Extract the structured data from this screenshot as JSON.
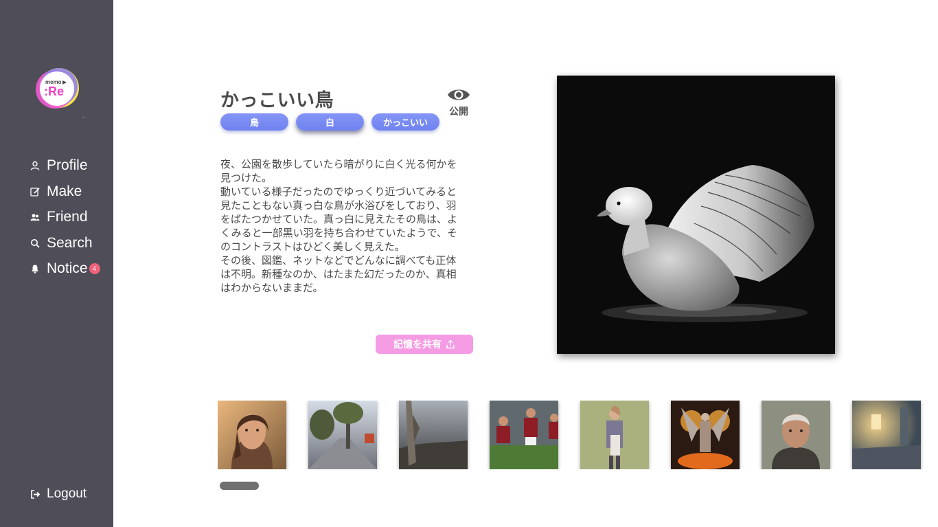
{
  "sidebar": {
    "logo_text_small": "memo",
    "logo_text_main": ":Re",
    "items": [
      {
        "label": "Profile",
        "icon": "user-icon"
      },
      {
        "label": "Make",
        "icon": "edit-icon"
      },
      {
        "label": "Friend",
        "icon": "friends-icon"
      },
      {
        "label": "Search",
        "icon": "search-icon"
      },
      {
        "label": "Notice",
        "icon": "bell-icon",
        "badge": "4"
      }
    ],
    "logout_label": "Logout"
  },
  "memory": {
    "title": "かっこいい鳥",
    "visibility_label": "公開",
    "tags": [
      "鳥",
      "白",
      "かっこいい"
    ],
    "description": "夜、公園を散歩していたら暗がりに白く光る何かを\n見つけた。\n動いている様子だったのでゆっくり近づいてみると\n見たこともない真っ白な鳥が水浴びをしており、羽\nをばたつかせていた。真っ白に見えたその鳥は、よ\nくみると一部黒い羽を持ち合わせていたようで、そ\nのコントラストはひどく美しく見えた。\nその後、図鑑、ネットなどでどんなに調べても正体\nは不明。新種なのか、はたまた幻だったのか、真相\nはわからないままだ。",
    "share_label": "記憶を共有"
  },
  "thumbnails": [
    {
      "subject": "woman-portrait"
    },
    {
      "subject": "tree-lined-street"
    },
    {
      "subject": "stormy-coast"
    },
    {
      "subject": "rugby-players"
    },
    {
      "subject": "woman-standing"
    },
    {
      "subject": "winged-warrior"
    },
    {
      "subject": "man-portrait"
    },
    {
      "subject": "ruined-interior"
    }
  ],
  "colors": {
    "sidebar_bg": "#4f4e58",
    "tag_bg": "#7587f3",
    "share_bg": "#f59be4",
    "badge_bg": "#f0617a"
  }
}
